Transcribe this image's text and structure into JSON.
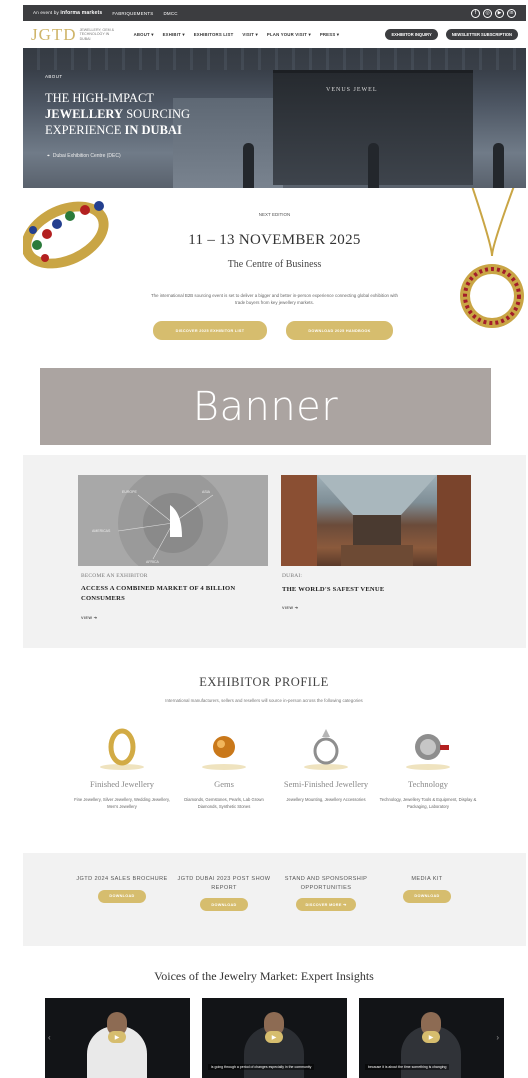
{
  "topbar": {
    "brand_prefix": "An event by",
    "brand": "informa markets",
    "partner1": "FABRIQUEMENTS",
    "partner2": "DMCC",
    "social": [
      "f",
      "◎",
      "▶",
      "in"
    ]
  },
  "nav": {
    "logo": "JGTD",
    "logo_sub": "JEWELLERY, GEM & TECHNOLOGY IN DUBAI",
    "menu": [
      "ABOUT ▾",
      "EXHIBIT ▾",
      "EXHIBITORS LIST",
      "VISIT ▾",
      "PLAN YOUR VISIT ▾",
      "PRESS ▾"
    ],
    "btn_inquiry": "EXHIBITOR INQUIRY",
    "btn_newsletter": "NEWSLETTER SUBSCRIPTION"
  },
  "hero": {
    "label": "ABOUT",
    "title_line1": "THE HIGH-IMPACT",
    "title_bold1": "JEWELLERY",
    "title_line2": " SOURCING",
    "title_line3": "EXPERIENCE ",
    "title_bold2": "IN DUBAI",
    "location": "Dubai Exhibition Centre (DEC)",
    "booth_sign": "VENUS JEWEL"
  },
  "edition": {
    "kicker": "NEXT EDITION",
    "date": "11 – 13 NOVEMBER 2025",
    "subtitle": "The Centre of Business",
    "description": "The international B2B sourcing event is set to deliver a bigger and better in-person experience connecting global exhibition with trade buyers from key jewellery markets.",
    "btn_exhibitor_list": "DISCOVER 2025 EXHIBITOR LIST",
    "btn_handbook": "DOWNLOAD 2025 HANDBOOK"
  },
  "banner": {
    "text": "Banner"
  },
  "cards": [
    {
      "kicker": "BECOME AN EXHIBITOR",
      "title": "ACCESS A COMBINED MARKET OF 4 BILLION CONSUMERS",
      "view": "VIEW ➔",
      "map_labels": [
        "EUROPE",
        "ASIA",
        "AMERICAS",
        "AFRICA"
      ]
    },
    {
      "kicker": "DUBAI:",
      "title": "THE WORLD'S SAFEST VENUE",
      "view": "VIEW ➔"
    }
  ],
  "profile": {
    "title": "EXHIBITOR PROFILE",
    "description": "International manufacturers, sellers and resellers will source in-person across the following categories",
    "categories": [
      {
        "name": "Finished Jewellery",
        "desc": "Fine Jewellery, Silver Jewellery, Wedding Jewellery, Men's Jewellery"
      },
      {
        "name": "Gems",
        "desc": "Diamonds, Gemstones, Pearls, Lab Grown Diamonds, Synthetic Stones"
      },
      {
        "name": "Semi-Finished Jewellery",
        "desc": "Jewellery Mounting, Jewellery Accessories"
      },
      {
        "name": "Technology",
        "desc": "Technology, Jewellery Tools & Equipment, Display & Packaging, Laboratory"
      }
    ]
  },
  "downloads": [
    {
      "title": "JGTD 2024 SALES BROCHURE",
      "btn": "DOWNLOAD"
    },
    {
      "title": "JGTD DUBAI 2023 POST SHOW REPORT",
      "btn": "DOWNLOAD"
    },
    {
      "title": "STAND AND SPONSORSHIP OPPORTUNITIES",
      "btn": "DISCOVER MORE ➔"
    },
    {
      "title": "MEDIA KIT",
      "btn": "DOWNLOAD"
    }
  ],
  "voices": {
    "title": "Voices of the Jewelry Market: Expert Insights",
    "captions": [
      "",
      "is going through a period of changes especially in the community",
      "because it is about the time something is changing"
    ]
  },
  "colors": {
    "gold": "#d6bd6e",
    "dark": "#3c3d40",
    "banner": "#aba4a1",
    "section_gray": "#f2f2f2"
  }
}
